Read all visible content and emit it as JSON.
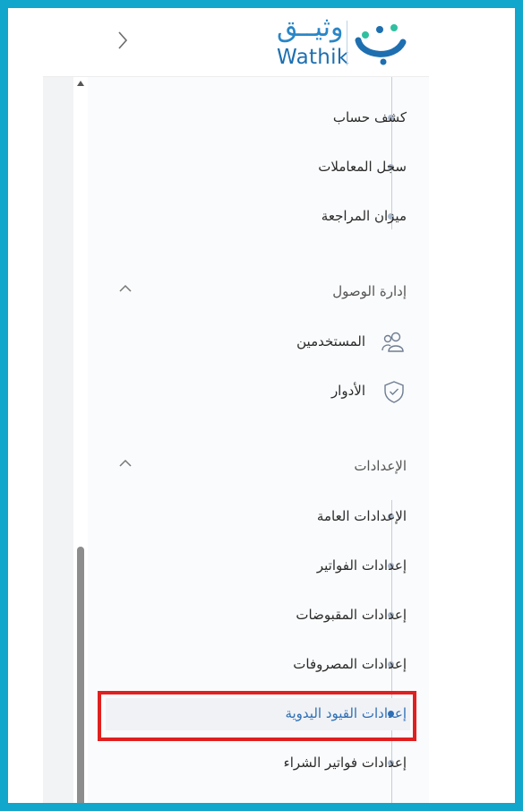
{
  "brand": {
    "logo_arabic": "وثيــق",
    "logo_english": "Wathik",
    "accent": "#11a6cc"
  },
  "header": {
    "collapse_icon": "chevron-right-icon"
  },
  "accounts_submenu": [
    {
      "label": "كشف حساب"
    },
    {
      "label": "سجل المعاملات"
    },
    {
      "label": "ميزان المراجعة"
    }
  ],
  "access_section": {
    "title": "إدارة الوصول",
    "expanded": true,
    "items": [
      {
        "label": "المستخدمين",
        "icon": "users-icon"
      },
      {
        "label": "الأدوار",
        "icon": "shield-check-icon"
      }
    ]
  },
  "settings_section": {
    "title": "الإعدادات",
    "expanded": true,
    "items": [
      {
        "label": "الإعدادات العامة"
      },
      {
        "label": "إعدادات الفواتير"
      },
      {
        "label": "إعدادات المقبوضات"
      },
      {
        "label": "إعدادات المصروفات"
      },
      {
        "label": "إعدادات القيود اليدوية",
        "active": true
      },
      {
        "label": "إعدادات فواتير الشراء"
      }
    ]
  },
  "highlight_color": "#e02020"
}
